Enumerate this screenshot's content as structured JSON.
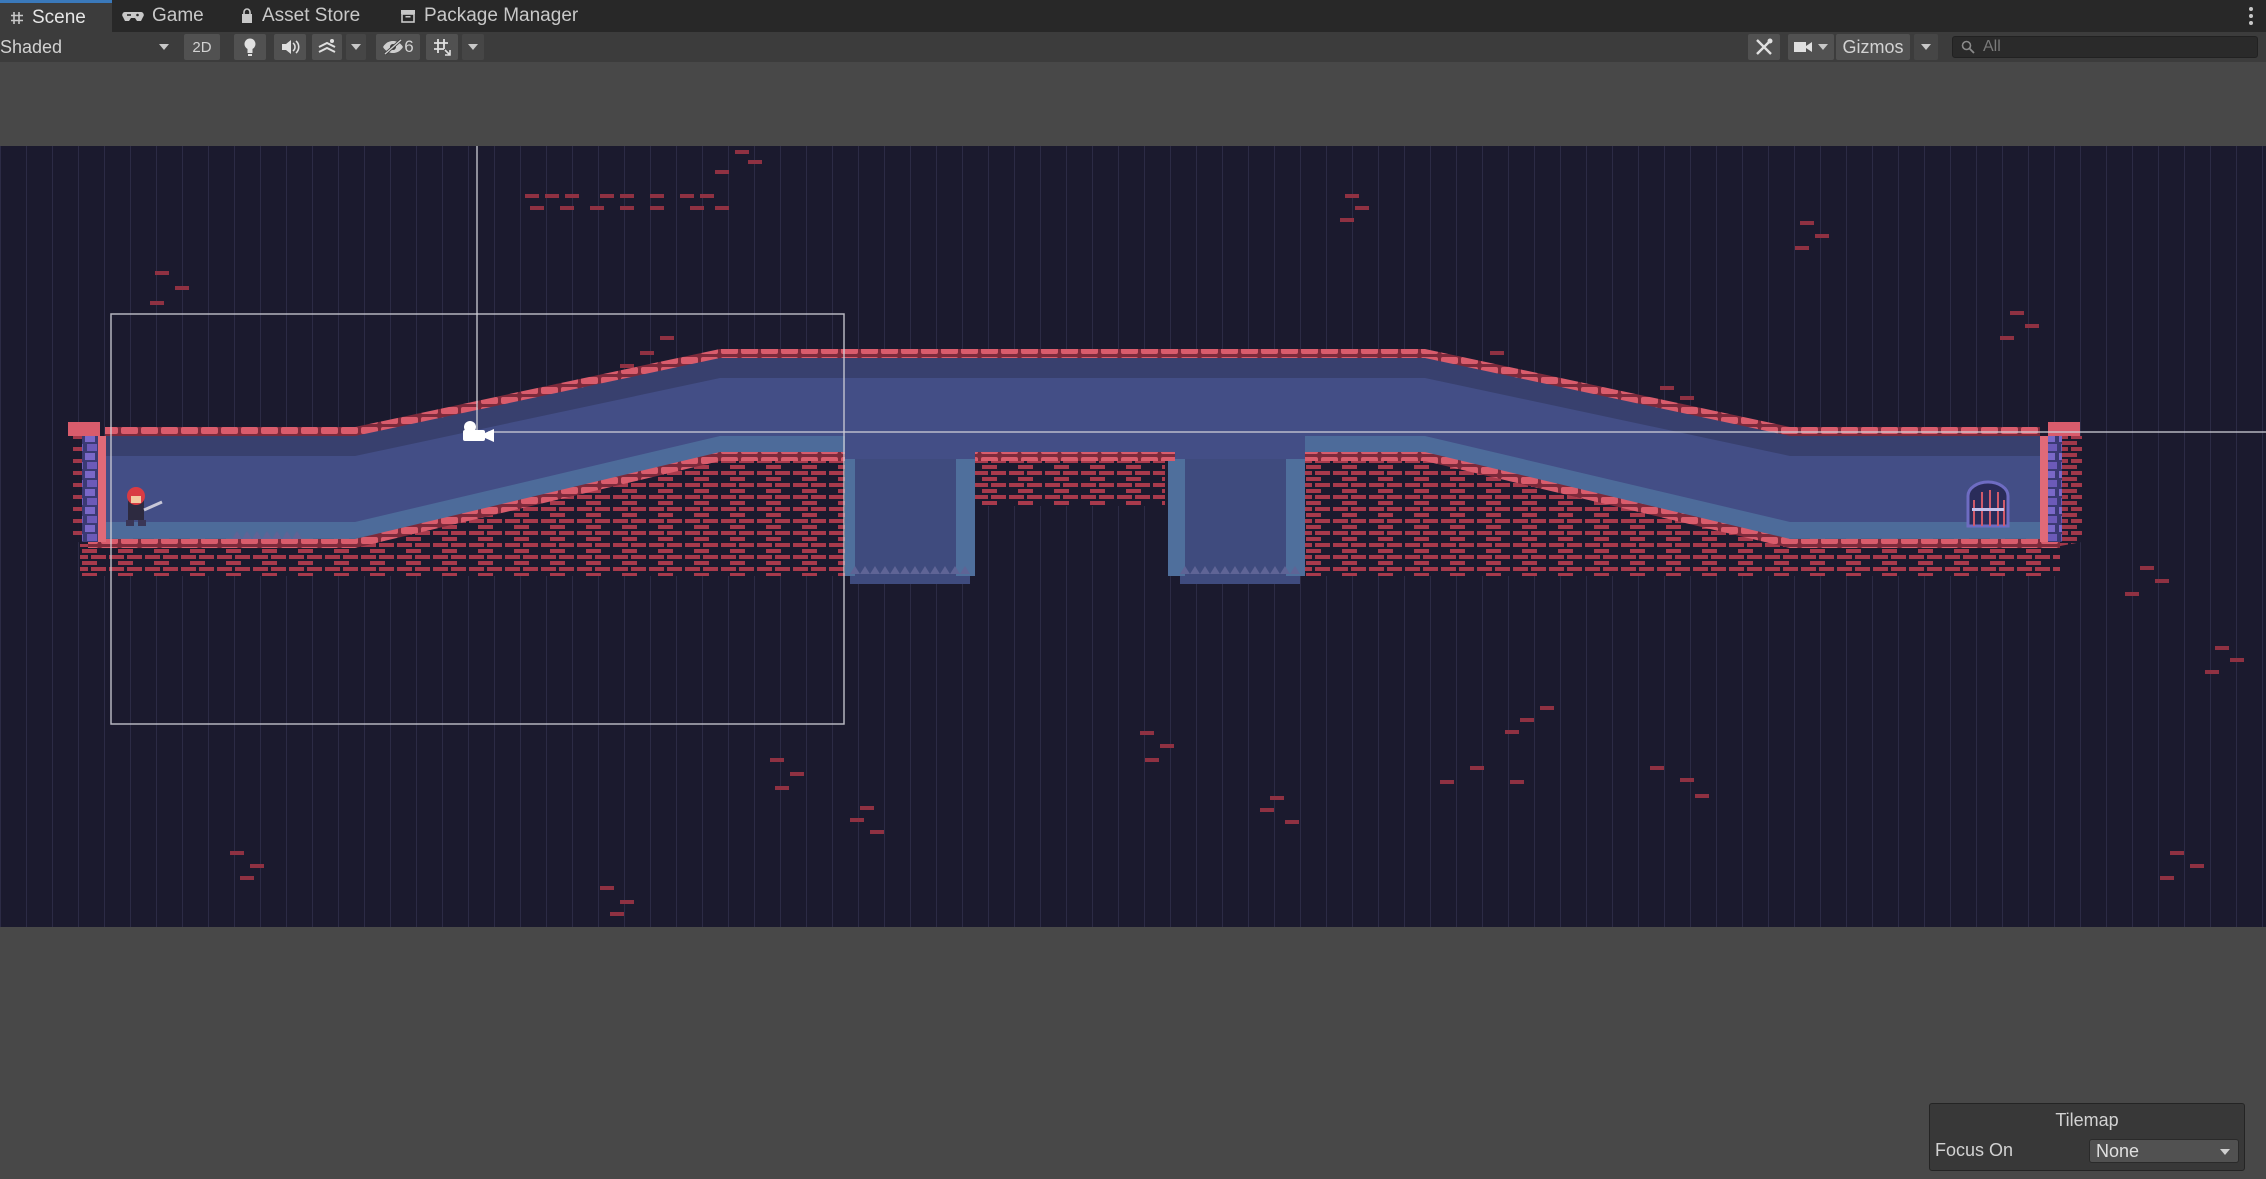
{
  "tabs": [
    {
      "label": "Scene",
      "icon": "hash-icon",
      "active": true
    },
    {
      "label": "Game",
      "icon": "gamepad-icon"
    },
    {
      "label": "Asset Store",
      "icon": "bag-icon"
    },
    {
      "label": "Package Manager",
      "icon": "package-icon"
    }
  ],
  "toolbar": {
    "draw_mode": "Shaded",
    "mode_2d": "2D",
    "hidden_count": "6",
    "gizmos": "Gizmos",
    "search_placeholder": "All"
  },
  "scene": {
    "icons": [
      "light-bulb-icon",
      "audio-icon",
      "effects-icon",
      "visibility-icon",
      "grid-snap-icon",
      "tools-icon",
      "camera-icon",
      "scene-camera-gizmo-icon",
      "player-character",
      "exit-door"
    ],
    "colors": {
      "background_sky": "#1b1a2e",
      "room_fill": "#434e86",
      "brick": "#c04455",
      "wall_trim": "#7a68c8",
      "water_channel": "#4f6f9c"
    }
  },
  "overlay": {
    "title": "Tilemap",
    "focus_label": "Focus On",
    "focus_value": "None"
  }
}
